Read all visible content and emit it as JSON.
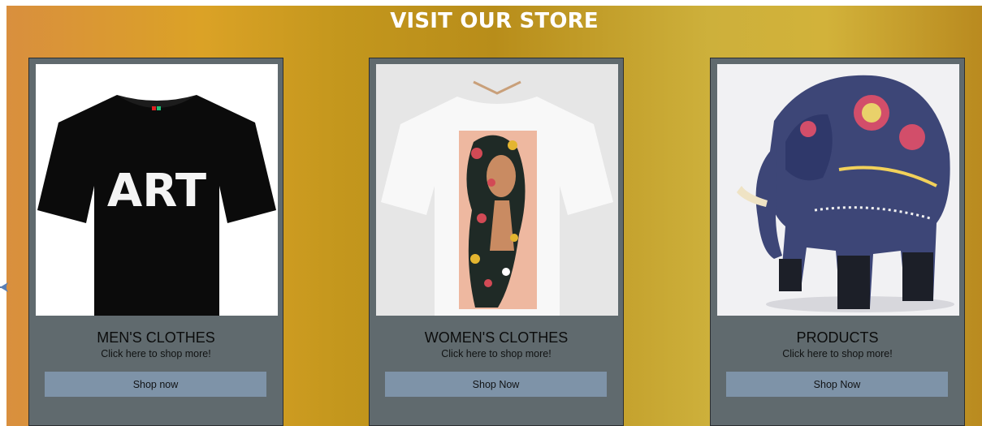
{
  "header": {
    "title": "VISIT OUR STORE"
  },
  "cards": [
    {
      "title": "MEN'S CLOTHES",
      "subtitle": "Click here to shop more!",
      "button_label": "Shop now",
      "image_text": "ART"
    },
    {
      "title": "WOMEN'S CLOTHES",
      "subtitle": "Click here to shop more!",
      "button_label": "Shop Now"
    },
    {
      "title": "PRODUCTS",
      "subtitle": "Click here to shop more!",
      "button_label": "Shop Now"
    }
  ],
  "colors": {
    "banner_gradient": [
      "#d98f3e",
      "#dba226",
      "#b88d1a",
      "#d2b23a",
      "#b98a1f"
    ],
    "card_background": "#606a6e",
    "button_background": "#7e93a8",
    "heading_text": "#ffffff"
  },
  "icons": [
    "arrow-right-icon"
  ]
}
